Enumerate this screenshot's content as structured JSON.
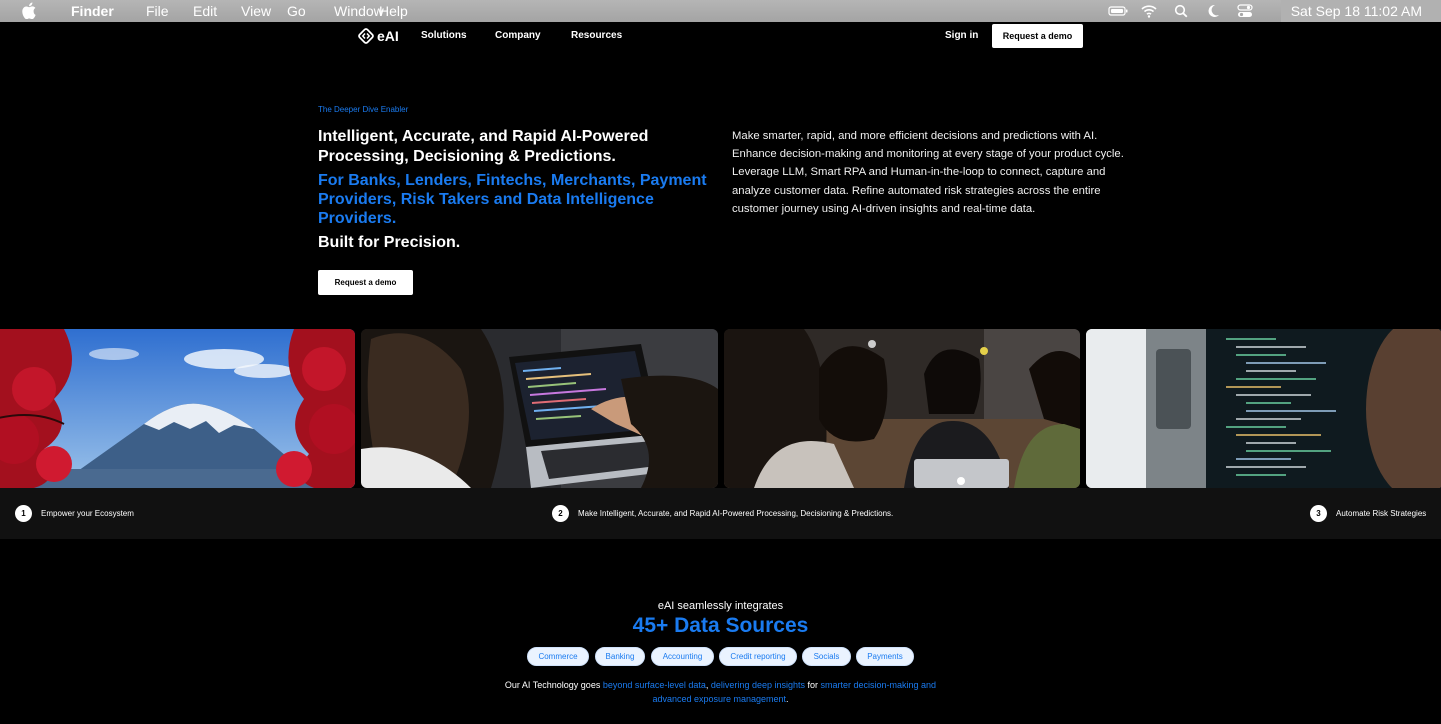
{
  "menubar": {
    "app": "Finder",
    "menus": [
      "File",
      "Edit",
      "View",
      "Go",
      "Window",
      "Help"
    ],
    "clock": "Sat Sep 18  11:02 AM"
  },
  "nav": {
    "logo_text": "eAI",
    "links": [
      "Solutions",
      "Company",
      "Resources"
    ],
    "sign_in": "Sign in",
    "cta": "Request a demo"
  },
  "hero": {
    "eyebrow": "The Deeper Dive Enabler",
    "headline": "Intelligent, Accurate, and Rapid AI-Powered Processing, Decisioning & Predictions.",
    "audience": "For Banks, Lenders, Fintechs, Merchants, Payment Providers, Risk Takers and Data Intelligence Providers.",
    "tagline": "Built for Precision.",
    "cta": "Request a demo",
    "description": "Make smarter, rapid, and more efficient decisions and predictions with AI. Enhance decision-making and monitoring at every stage of your product cycle. Leverage LLM, Smart RPA and Human-in-the-loop to connect, capture and analyze customer data. Refine automated risk strategies across the entire customer journey using AI-driven insights and real-time data."
  },
  "steps": [
    {
      "num": "1",
      "label": "Empower your Ecosystem"
    },
    {
      "num": "2",
      "label": "Make Intelligent, Accurate, and Rapid AI-Powered Processing, Decisioning & Predictions."
    },
    {
      "num": "3",
      "label": "Automate Risk Strategies"
    }
  ],
  "integrations": {
    "intro": "eAI seamlessly integrates",
    "headline": "45+ Data Sources",
    "categories": [
      "Commerce",
      "Banking",
      "Accounting",
      "Credit reporting",
      "Socials",
      "Payments"
    ],
    "text_parts": {
      "a": "Our AI Technology goes ",
      "b": "beyond surface-level data",
      "c": ", ",
      "d": "delivering deep insights",
      "e": " for ",
      "f": "smarter decision-making and advanced exposure management",
      "g": "."
    }
  },
  "colors": {
    "accent": "#1a7bf0",
    "background": "#000000",
    "steps_bar": "#111111"
  }
}
